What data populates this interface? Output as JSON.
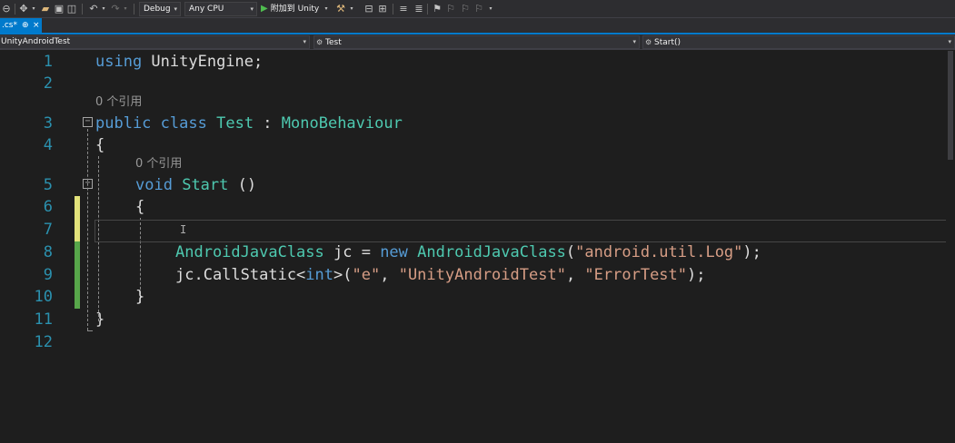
{
  "toolbar": {
    "config": "Debug",
    "platform": "Any CPU",
    "attach_label": "附加到 Unity"
  },
  "tab": {
    "name": ".cs*",
    "pin": "⊕",
    "close": "×"
  },
  "navbar": {
    "project": "UnityAndroidTest",
    "class": "Test",
    "member": "Start()"
  },
  "editor": {
    "line_numbers": [
      "1",
      "2",
      "3",
      "4",
      "5",
      "6",
      "7",
      "8",
      "9",
      "10",
      "11",
      "12"
    ],
    "codelens_class": "0 个引用",
    "codelens_method": "0 个引用",
    "line1_kw": "using",
    "line1_rest": " UnityEngine;",
    "line3_kw1": "public",
    "line3_kw2": "class",
    "line3_name": "Test",
    "line3_colon": " : ",
    "line3_base": "MonoBehaviour",
    "line4": "{",
    "line5_kw": "void",
    "line5_name": "Start",
    "line5_rest": " ()",
    "line6": "{",
    "line8_type1": "AndroidJavaClass",
    "line8_mid": " jc = ",
    "line8_kw": "new",
    "line8_type2": "AndroidJavaClass",
    "line8_open": "(",
    "line8_str": "\"android.util.Log\"",
    "line8_close": ");",
    "line9_a": "jc.CallStatic<",
    "line9_kw": "int",
    "line9_b": ">(",
    "line9_s1": "\"e\"",
    "line9_c1": ", ",
    "line9_s2": "\"UnityAndroidTest\"",
    "line9_c2": ", ",
    "line9_s3": "\"ErrorTest\"",
    "line9_end": ");",
    "line10": "}",
    "line11": "}"
  }
}
